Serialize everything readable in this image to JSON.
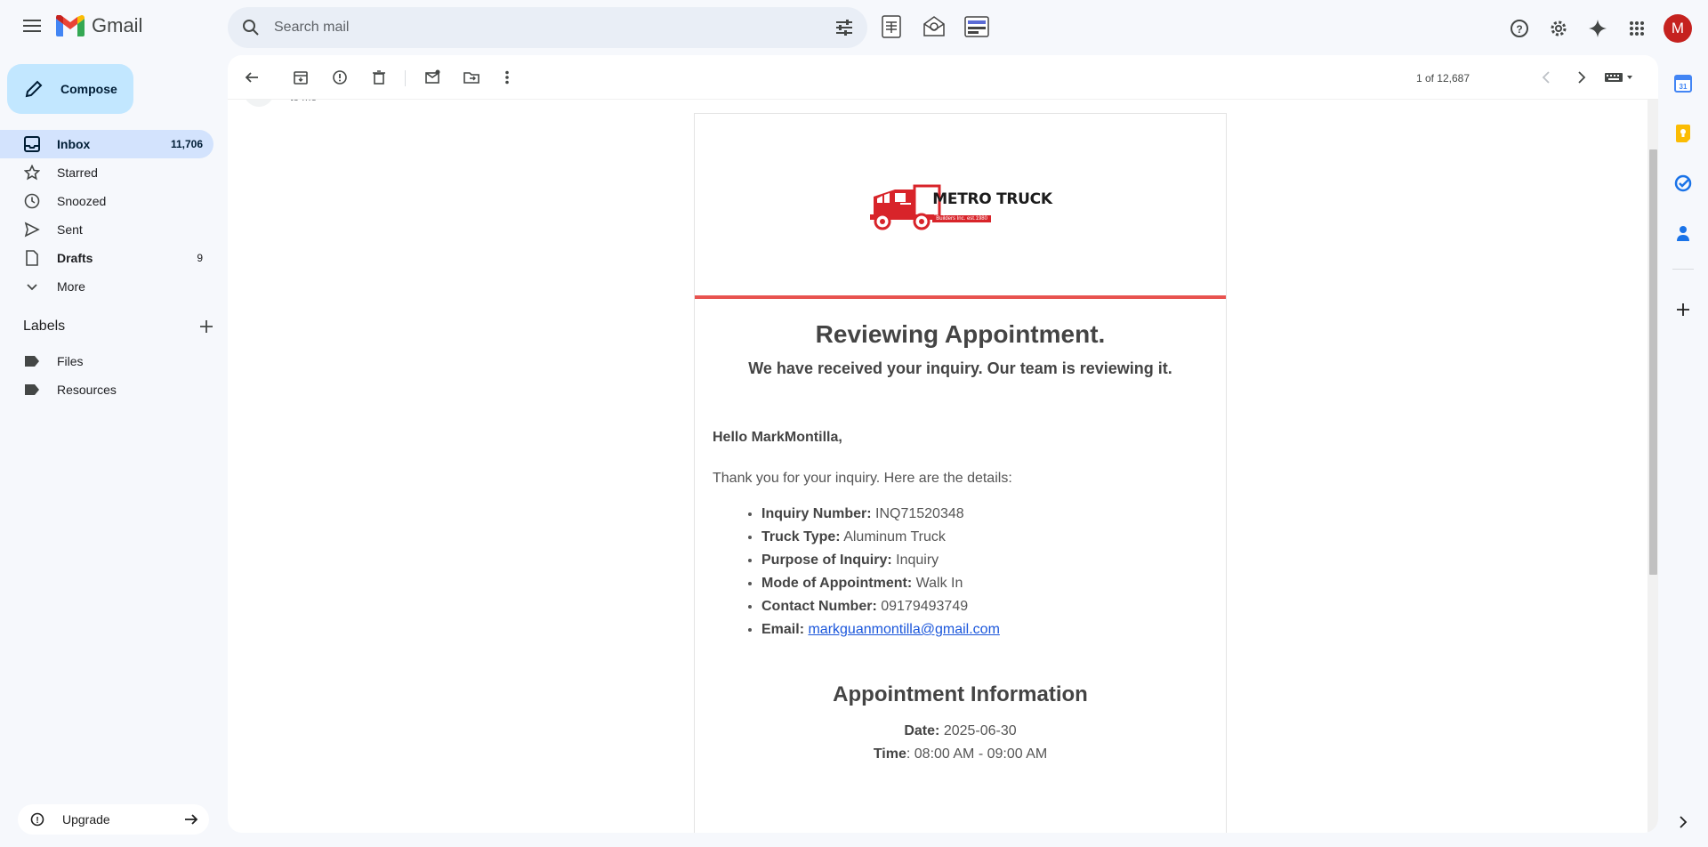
{
  "app": {
    "name": "Gmail"
  },
  "search": {
    "placeholder": "Search mail"
  },
  "profile": {
    "initial": "M",
    "color": "#c5221f"
  },
  "compose": {
    "label": "Compose"
  },
  "nav": [
    {
      "label": "Inbox",
      "count": "11,706",
      "icon": "inbox-icon"
    },
    {
      "label": "Starred",
      "count": "",
      "icon": "star-icon"
    },
    {
      "label": "Snoozed",
      "count": "",
      "icon": "clock-icon"
    },
    {
      "label": "Sent",
      "count": "",
      "icon": "send-icon"
    },
    {
      "label": "Drafts",
      "count": "9",
      "icon": "draft-icon"
    },
    {
      "label": "More",
      "count": "",
      "icon": "chevron-down-icon"
    }
  ],
  "labels": {
    "title": "Labels",
    "items": [
      "Files",
      "Resources"
    ]
  },
  "upgrade": {
    "label": "Upgrade"
  },
  "toolbar": {
    "pager": "1 of 12,687"
  },
  "sender_stub": "to me",
  "email": {
    "brand": {
      "name": "METRO TRUCK",
      "sub": "Builders Inc. est.1980"
    },
    "title": "Reviewing Appointment.",
    "subtitle": "We have received your inquiry. Our team is reviewing it.",
    "greeting": "Hello MarkMontilla,",
    "intro": "Thank you for your inquiry. Here are the details:",
    "details": [
      {
        "label": "Inquiry Number:",
        "value": "INQ71520348"
      },
      {
        "label": "Truck Type:",
        "value": "Aluminum Truck"
      },
      {
        "label": "Purpose of Inquiry:",
        "value": "Inquiry"
      },
      {
        "label": "Mode of Appointment:",
        "value": "Walk In"
      },
      {
        "label": "Contact Number:",
        "value": "09179493749"
      },
      {
        "label": "Email:",
        "value": "markguanmontilla@gmail.com"
      }
    ],
    "appointment": {
      "title": "Appointment Information",
      "date_label": "Date:",
      "date": "2025-06-30",
      "time_label": "Time",
      "time": ": 08:00 AM - 09:00 AM"
    }
  },
  "colors": {
    "accent": "#e8534f",
    "compose_bg": "#c2e7ff",
    "active_nav": "#d3e3fd"
  }
}
